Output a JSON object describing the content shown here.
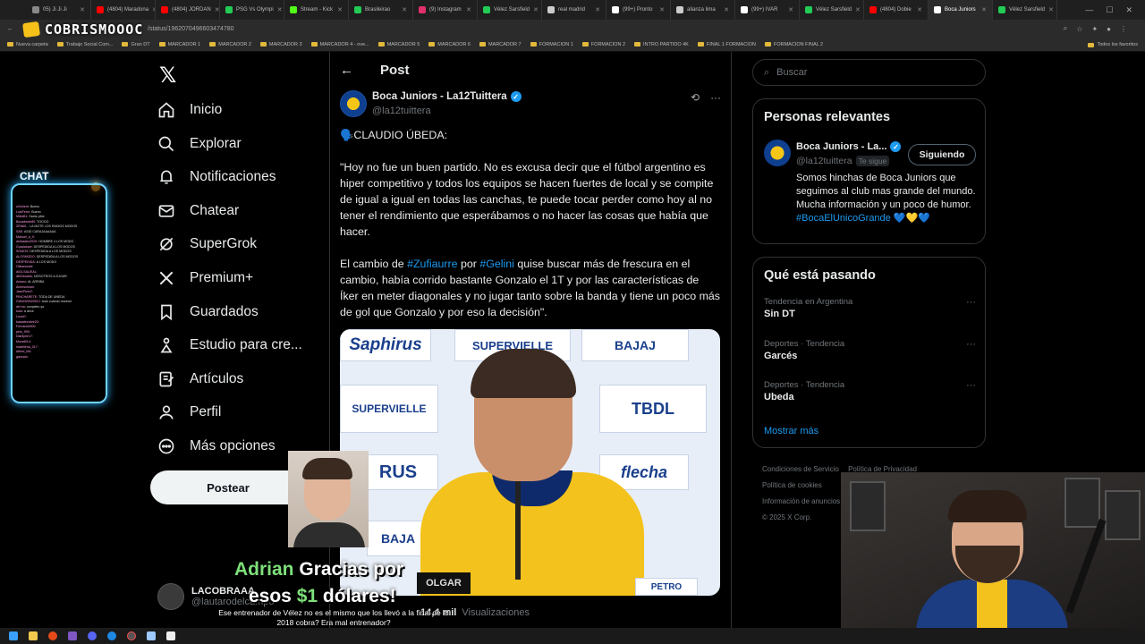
{
  "browser": {
    "tabs": [
      {
        "label": "05) Ji Ji Ji",
        "color": "#888888"
      },
      {
        "label": "(4804) Maradona",
        "color": "#ff0000"
      },
      {
        "label": "(4804) JORDAN",
        "color": "#ff0000"
      },
      {
        "label": "PSG Vs Olympi",
        "color": "#22cc55"
      },
      {
        "label": "Stream - Kick",
        "color": "#53fc18"
      },
      {
        "label": "Brasileirao",
        "color": "#22cc55"
      },
      {
        "label": "(9) Instagram",
        "color": "#e1306c"
      },
      {
        "label": "Vélez Sarsfield",
        "color": "#22cc55"
      },
      {
        "label": "real madrid",
        "color": "#cccccc"
      },
      {
        "label": "(99+) Pronto",
        "color": "#ffffff"
      },
      {
        "label": "alianza lima",
        "color": "#cccccc"
      },
      {
        "label": "(99+) IVAR",
        "color": "#ffffff"
      },
      {
        "label": "Vélez Sarsfield",
        "color": "#22cc55"
      },
      {
        "label": "(4804) Dobie",
        "color": "#ff0000"
      },
      {
        "label": "Boca Juniors",
        "color": "#ffffff"
      },
      {
        "label": "Vélez Sarsfield",
        "color": "#22cc55"
      }
    ],
    "url": "/status/1962070496603474780",
    "bookmarks": [
      "Nueva carpeta",
      "Trabajo Social Com...",
      "Gran DT",
      "MARCADOR 1",
      "MARCADOR 2",
      "MARCADOR 3",
      "MARCADOR 4 - ove...",
      "MARCADOR 5",
      "MARCADOR 6",
      "MARCADOR 7",
      "FORMACION 1",
      "FORMACION 2",
      "INTRO PARTIDO 4K",
      "FINAL 1 FORMACION",
      "FORMACION FINAL 2"
    ],
    "all_bookmarks": "Todos los favoritos"
  },
  "stream": {
    "logo": "COBRISMOOOC",
    "chat_title": "CHAT",
    "chat_lines": [
      {
        "u": "wOclient:",
        "t": "Bueno"
      },
      {
        "u": "LuisFerrn:",
        "t": "Bueno"
      },
      {
        "u": "Mikel61:",
        "t": "Santo pibe"
      },
      {
        "u": "Bocadente80:",
        "t": "TOOOO"
      },
      {
        "u": "ZEN60...",
        "t": "LA MOTE LOS RADIOS MODOS"
      },
      {
        "u": "SAE:",
        "t": "ASID CARAJAAAAAA"
      },
      {
        "u": "Manuel_a_X:",
        "t": ""
      },
      {
        "u": "delicadez2020:",
        "t": "HOMBRE 4 LOS MODO"
      },
      {
        "u": "Guadalupe:",
        "t": "DESPEDIDA A LOS MODOS"
      },
      {
        "u": "SOMOS:",
        "t": "DESPEDIDA A LOS MODOS"
      },
      {
        "u": "ALOSMODO:",
        "t": "DESPEDIDA A LOS MODOS"
      },
      {
        "u": "DESPEDIDA:",
        "t": "A LOS MODO"
      },
      {
        "u": "Olleanunde:",
        "t": ""
      },
      {
        "u": "AIGLSALIEAL:",
        "t": ""
      },
      {
        "u": "dblOsvaldo:",
        "t": "NOSOTROS A JUGAR"
      },
      {
        "u": "Aniano:",
        "t": "AL ARRIBA"
      },
      {
        "u": "Achesolman:",
        "t": ""
      },
      {
        "u": "JasePiver2:",
        "t": ""
      },
      {
        "u": "PINCHARETE:",
        "t": "TODA DE UNEDA"
      },
      {
        "u": "GiHoN20020012:",
        "t": "todo cuando resolver"
      },
      {
        "u": "del ea:",
        "t": "completo ya"
      },
      {
        "u": "todo:",
        "t": "a decir"
      },
      {
        "u": "LucaO:",
        "t": ""
      },
      {
        "u": "basadecobre20:",
        "t": ""
      },
      {
        "u": "Fernando900:",
        "t": ""
      },
      {
        "u": "pelo_990:",
        "t": ""
      },
      {
        "u": "Diarilyee17:",
        "t": ""
      },
      {
        "u": "Mozat014:",
        "t": ""
      },
      {
        "u": "madrilena_017:",
        "t": ""
      },
      {
        "u": "Alfred_M4:",
        "t": ""
      },
      {
        "u": "ganzalo:",
        "t": ""
      }
    ],
    "donation_user": "Adrian",
    "donation_text_1": "Gracias por",
    "donation_text_2a": "esos",
    "donation_amount": "$1",
    "donation_text_2b": "dólares!",
    "donation_message": "Ese entrenador de Vélez no es el mismo que los llevó a la final de el 2018 cobra? Era mal entrenador?"
  },
  "nav": {
    "items": [
      {
        "label": "Inicio",
        "icon": "home-icon"
      },
      {
        "label": "Explorar",
        "icon": "search-icon"
      },
      {
        "label": "Notificaciones",
        "icon": "bell-icon"
      },
      {
        "label": "Chatear",
        "icon": "mail-icon"
      },
      {
        "label": "SuperGrok",
        "icon": "grok-icon"
      },
      {
        "label": "Premium+",
        "icon": "x-icon"
      },
      {
        "label": "Guardados",
        "icon": "bookmark-icon"
      },
      {
        "label": "Estudio para cre...",
        "icon": "creator-icon"
      },
      {
        "label": "Artículos",
        "icon": "article-icon"
      },
      {
        "label": "Perfil",
        "icon": "user-icon"
      },
      {
        "label": "Más opciones",
        "icon": "more-icon"
      }
    ],
    "post_button": "Postear",
    "account_name": "LACOBRAAA",
    "account_handle": "@lautarodelcampo"
  },
  "post": {
    "header": "Post",
    "author_name": "Boca Juniors - La12Tuittera",
    "author_handle": "@la12tuittera",
    "speaker": "🗣️CLAUDIO ÚBEDA:",
    "quote": "\"Hoy no fue un buen partido. No es excusa decir que el fútbol argentino es hiper competitivo y todos los equipos se hacen fuertes de local y se compite de igual a igual en todas las canchas, te puede tocar perder como hoy al no tener el rendimiento que esperábamos o no hacer las cosas que había que hacer.",
    "p2_a": "El cambio de ",
    "p2_tag1": "#Zufiaurre",
    "p2_b": " por ",
    "p2_tag2": "#Gelini",
    "p2_c": " quise buscar más de frescura en el cambio, había corrido bastante Gonzalo el 1T y por las características de Íker en meter diagonales y no jugar tanto sobre la banda y tiene un poco más de gol que Gonzalo y por eso la decisión\".",
    "sponsors": [
      "Saphirus",
      "SUPERVIELLE",
      "BAJAJ",
      "SUPERVIELLE",
      "TBDL",
      "RUS",
      "flecha",
      "BAJA",
      "OLGAR",
      "PETRO"
    ],
    "views_count": "14,4 mil",
    "views_label": "Visualizaciones"
  },
  "sidebar": {
    "search_placeholder": "Buscar",
    "relevant_title": "Personas relevantes",
    "rel_name": "Boca Juniors - La...",
    "rel_handle": "@la12tuittera",
    "rel_follows_you": "Te sigue",
    "rel_button": "Siguiendo",
    "rel_bio_a": "Somos hinchas de Boca Juniors que seguimos al club mas grande del mundo. Mucha información y un poco de humor. ",
    "rel_bio_tag": "#BocaElUnicoGrande",
    "rel_bio_emoji": " 💙💛💙",
    "trends_title": "Qué está pasando",
    "trends": [
      {
        "category": "Tendencia en Argentina",
        "name": "Sin DT"
      },
      {
        "category": "Deportes · Tendencia",
        "name": "Garcés"
      },
      {
        "category": "Deportes · Tendencia",
        "name": "Ubeda"
      }
    ],
    "show_more": "Mostrar más",
    "footer": [
      "Condiciones de Servicio",
      "Política de Privacidad",
      "Política de cookies",
      "Información de anuncios",
      "© 2025 X Corp."
    ]
  }
}
